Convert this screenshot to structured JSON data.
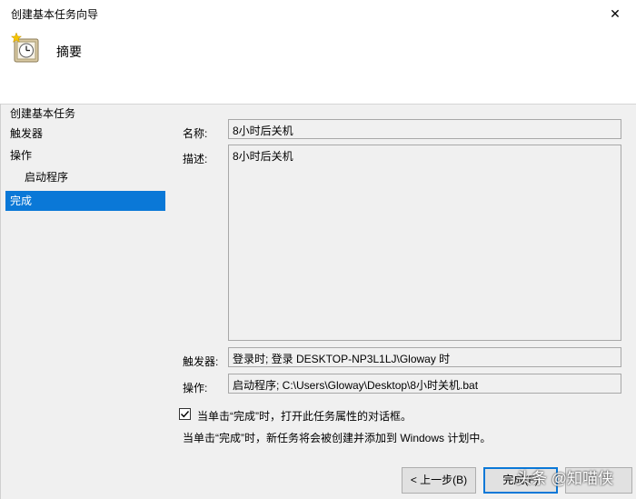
{
  "window": {
    "title": "创建基本任务向导",
    "close_glyph": "✕"
  },
  "header": {
    "icon": "clock-icon",
    "heading": "摘要"
  },
  "sidebar": {
    "items": [
      {
        "label": "创建基本任务"
      },
      {
        "label": "触发器"
      },
      {
        "label": "操作"
      },
      {
        "label": "启动程序"
      },
      {
        "label": "完成"
      }
    ],
    "selected_index": 4
  },
  "summary": {
    "name_label": "名称:",
    "name_value": "8小时后关机",
    "description_label": "描述:",
    "description_value": "8小时后关机",
    "trigger_label": "触发器:",
    "trigger_value": "登录时; 登录 DESKTOP-NP3L1LJ\\Gloway 时",
    "action_label": "操作:",
    "action_value": "启动程序; C:\\Users\\Gloway\\Desktop\\8小时关机.bat"
  },
  "options": {
    "open_properties_checked": true,
    "open_properties_label": "当单击“完成”时，打开此任务属性的对话框。",
    "note": "当单击“完成”时，新任务将会被创建并添加到 Windows 计划中。"
  },
  "buttons": {
    "back_label": "< 上一步(B)",
    "finish_label": "完成(F)"
  },
  "watermark": "头条 @知喵侠",
  "colors": {
    "selection": "#0a78d7",
    "background": "#f0f0f0"
  }
}
